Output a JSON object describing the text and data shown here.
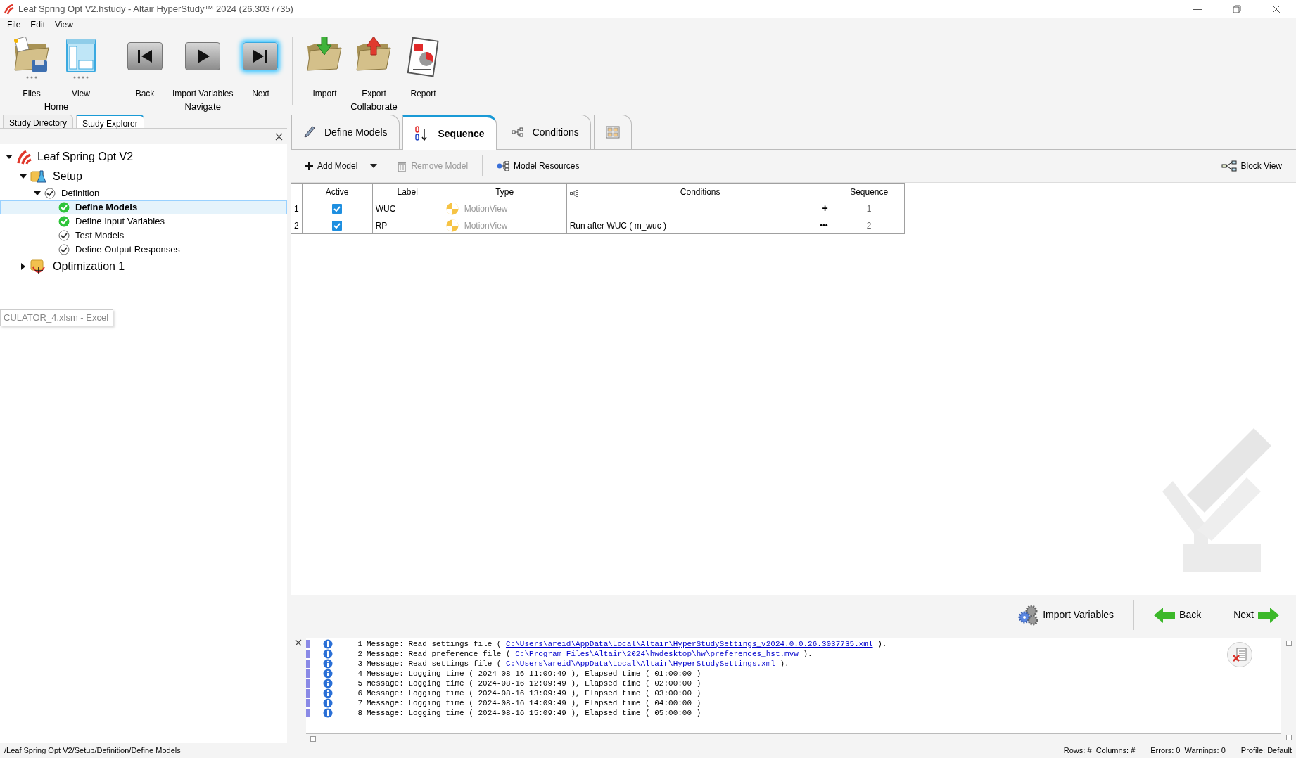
{
  "window": {
    "title": "Leaf Spring Opt V2.hstudy - Altair HyperStudy™ 2024 (26.3037735)"
  },
  "menu": [
    "File",
    "Edit",
    "View"
  ],
  "ribbon": [
    {
      "label": "Home",
      "buttons": [
        {
          "label": "Files",
          "kind": "files",
          "highlighted": false
        },
        {
          "label": "View",
          "kind": "view",
          "highlighted": false
        }
      ]
    },
    {
      "label": "Navigate",
      "buttons": [
        {
          "label": "Back",
          "kind": "back",
          "highlighted": false
        },
        {
          "label": "Import Variables",
          "kind": "play",
          "highlighted": false
        },
        {
          "label": "Next",
          "kind": "next",
          "highlighted": true
        }
      ]
    },
    {
      "label": "Collaborate",
      "buttons": [
        {
          "label": "Import",
          "kind": "import",
          "highlighted": false
        },
        {
          "label": "Export",
          "kind": "export",
          "highlighted": false
        },
        {
          "label": "Report",
          "kind": "report",
          "highlighted": false
        }
      ]
    }
  ],
  "explorer": {
    "tabs": [
      {
        "label": "Study Directory",
        "selected": false
      },
      {
        "label": "Study Explorer",
        "selected": true
      }
    ],
    "tree": [
      {
        "label": "Leaf Spring Opt V2",
        "kind": "study",
        "expanded": true,
        "selected": false,
        "children": [
          {
            "label": "Setup",
            "kind": "setup",
            "expanded": true,
            "selected": false,
            "children": [
              {
                "label": "Definition",
                "kind": "step",
                "complete": false,
                "expanded": true,
                "selected": false,
                "children": [
                  {
                    "label": "Define Models",
                    "kind": "step",
                    "complete": true,
                    "selected": true
                  },
                  {
                    "label": "Define Input Variables",
                    "kind": "step",
                    "complete": true,
                    "selected": false
                  },
                  {
                    "label": "Test Models",
                    "kind": "step",
                    "complete": false,
                    "selected": false
                  },
                  {
                    "label": "Define Output Responses",
                    "kind": "step",
                    "complete": false,
                    "selected": false
                  }
                ]
              }
            ]
          },
          {
            "label": "Optimization 1",
            "kind": "optimization",
            "expanded": false,
            "selected": false
          }
        ]
      }
    ]
  },
  "tooltip": {
    "text": "CULATOR_4.xlsm - Excel"
  },
  "tabs": [
    {
      "label": "Define Models",
      "kind": "define",
      "selected": false
    },
    {
      "label": "Sequence",
      "kind": "sequence",
      "selected": true
    },
    {
      "label": "Conditions",
      "kind": "conditions",
      "selected": false
    },
    {
      "kind": "grid",
      "selected": false
    }
  ],
  "toolbar": [
    {
      "label": "Add Model",
      "kind": "add",
      "disabled": false
    },
    {
      "kind": "dropdown",
      "disabled": false
    },
    {
      "label": "Remove Model",
      "kind": "remove",
      "disabled": true
    },
    {
      "label": "Model Resources",
      "kind": "resources",
      "disabled": false
    }
  ],
  "block_view": {
    "label": "Block View"
  },
  "table": {
    "columns": [
      "Active",
      "Label",
      "Type",
      "Conditions",
      "Sequence"
    ],
    "rows": [
      {
        "number": "1",
        "active": true,
        "label": "WUC",
        "type": "MotionView",
        "action": "+",
        "sequence": "1"
      },
      {
        "number": "2",
        "active": true,
        "label": "RP",
        "type": "MotionView",
        "conditions": "Run after WUC ( m_wuc )",
        "action": "•••",
        "sequence": "2"
      }
    ]
  },
  "navigation": [
    {
      "label": "Import Variables",
      "kind": "import"
    },
    {
      "label": "Back",
      "kind": "back"
    },
    {
      "label": "Next",
      "kind": "next"
    }
  ],
  "log": [
    {
      "number": "1",
      "text": "Message: Read settings file ( ",
      "link": "C:\\Users\\areid\\AppData\\Local\\Altair\\HyperStudySettings_v2024.0.0.26.3037735.xml",
      "suffix": " )."
    },
    {
      "number": "2",
      "text": "Message: Read preference file ( ",
      "link": "C:\\Program Files\\Altair\\2024\\hwdesktop\\hw\\preferences_hst.mvw",
      "suffix": " )."
    },
    {
      "number": "3",
      "text": "Message: Read settings file ( ",
      "link": "C:\\Users\\areid\\AppData\\Local\\Altair\\HyperStudySettings.xml",
      "suffix": " )."
    },
    {
      "number": "4",
      "text": "Message: Logging time ( 2024-08-16 11:09:49 ), Elapsed time ( 01:00:00 )"
    },
    {
      "number": "5",
      "text": "Message: Logging time ( 2024-08-16 12:09:49 ), Elapsed time ( 02:00:00 )"
    },
    {
      "number": "6",
      "text": "Message: Logging time ( 2024-08-16 13:09:49 ), Elapsed time ( 03:00:00 )"
    },
    {
      "number": "7",
      "text": "Message: Logging time ( 2024-08-16 14:09:49 ), Elapsed time ( 04:00:00 )"
    },
    {
      "number": "8",
      "text": "Message: Logging time ( 2024-08-16 15:09:49 ), Elapsed time ( 05:00:00 )"
    }
  ],
  "status_bar": {
    "path": "/Leaf Spring Opt V2/Setup/Definition/Define Models",
    "items": [
      "Rows: #  Columns: #",
      "Errors: 0  Warnings: 0",
      "Profile: Default"
    ]
  }
}
